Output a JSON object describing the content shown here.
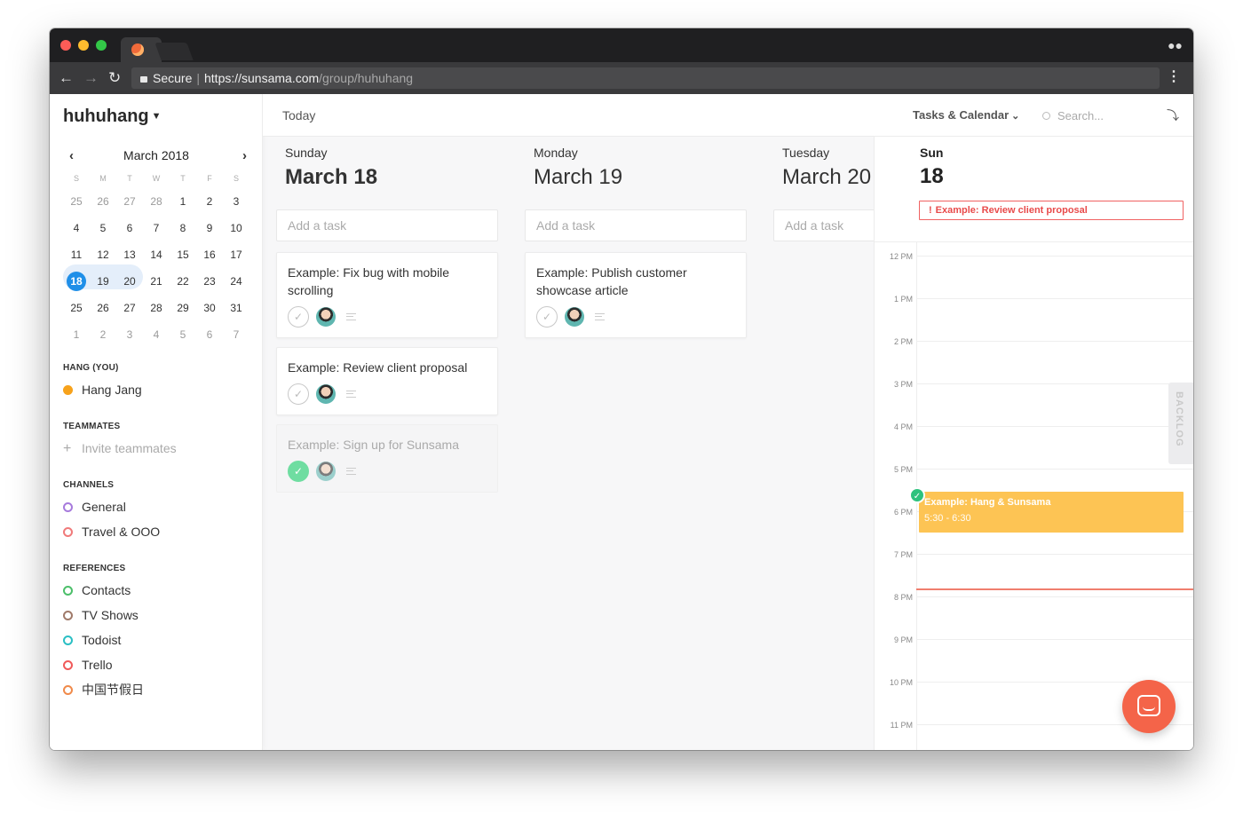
{
  "browser": {
    "secure_label": "Secure",
    "url_host": "https://sunsama.com",
    "url_path": "/group/huhuhang"
  },
  "sidebar": {
    "workspace": "huhuhang",
    "calendar": {
      "month": "March 2018",
      "weekdays": [
        "S",
        "M",
        "T",
        "W",
        "T",
        "F",
        "S"
      ],
      "weeks": [
        [
          "25",
          "26",
          "27",
          "28",
          "1",
          "2",
          "3"
        ],
        [
          "4",
          "5",
          "6",
          "7",
          "8",
          "9",
          "10"
        ],
        [
          "11",
          "12",
          "13",
          "14",
          "15",
          "16",
          "17"
        ],
        [
          "18",
          "19",
          "20",
          "21",
          "22",
          "23",
          "24"
        ],
        [
          "25",
          "26",
          "27",
          "28",
          "29",
          "30",
          "31"
        ],
        [
          "1",
          "2",
          "3",
          "4",
          "5",
          "6",
          "7"
        ]
      ],
      "today": "18"
    },
    "you_title": "HANG (YOU)",
    "you_name": "Hang Jang",
    "teammates_title": "TEAMMATES",
    "invite_label": "Invite teammates",
    "channels_title": "CHANNELS",
    "channels": [
      {
        "label": "General",
        "color": "#a77bdc"
      },
      {
        "label": "Travel & OOO",
        "color": "#f07a7a"
      }
    ],
    "references_title": "REFERENCES",
    "references": [
      {
        "label": "Contacts",
        "color": "#4cbf6a"
      },
      {
        "label": "TV Shows",
        "color": "#a07a6a"
      },
      {
        "label": "Todoist",
        "color": "#2bbfc4"
      },
      {
        "label": "Trello",
        "color": "#f05a5a"
      },
      {
        "label": "中国节假日",
        "color": "#f08a4a"
      }
    ],
    "you_color": "#f7a21b"
  },
  "topbar": {
    "today": "Today",
    "view": "Tasks & Calendar",
    "search_placeholder": "Search..."
  },
  "days": [
    {
      "name": "Sunday",
      "date": "March 18",
      "add_task": "Add a task",
      "tasks": [
        {
          "title": "Example: Fix bug with mobile scrolling",
          "done": false
        },
        {
          "title": "Example: Review client proposal",
          "done": false
        },
        {
          "title": "Example: Sign up for Sunsama",
          "done": true
        }
      ]
    },
    {
      "name": "Monday",
      "date": "March 19",
      "add_task": "Add a task",
      "tasks": [
        {
          "title": "Example: Publish customer showcase article",
          "done": false
        }
      ]
    },
    {
      "name": "Tuesday",
      "date": "March 20",
      "add_task": "Add a task",
      "tasks": []
    }
  ],
  "calendar_panel": {
    "day_name": "Sun",
    "day_num": "18",
    "allday_event": "Example: Review client proposal",
    "hours": [
      "12 PM",
      "1 PM",
      "2 PM",
      "3 PM",
      "4 PM",
      "5 PM",
      "6 PM",
      "7 PM",
      "8 PM",
      "9 PM",
      "10 PM",
      "11 PM"
    ],
    "event": {
      "title": "Example: Hang & Sunsama",
      "time": "5:30 - 6:30"
    },
    "backlog_label": "BACKLOG"
  }
}
